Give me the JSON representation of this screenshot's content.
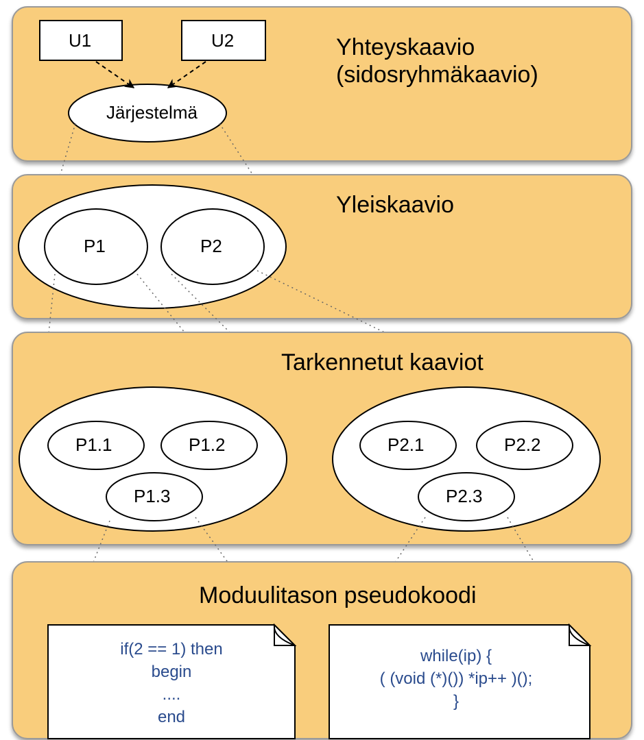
{
  "panels": {
    "context": {
      "title_line1": "Yhteyskaavio",
      "title_line2": "(sidosryhmäkaavio)",
      "actors": {
        "u1": "U1",
        "u2": "U2"
      },
      "system": "Järjestelmä"
    },
    "overview": {
      "title": "Yleiskaavio",
      "processes": {
        "p1": "P1",
        "p2": "P2"
      }
    },
    "detailed": {
      "title": "Tarkennetut kaaviot",
      "left": {
        "p11": "P1.1",
        "p12": "P1.2",
        "p13": "P1.3"
      },
      "right": {
        "p21": "P2.1",
        "p22": "P2.2",
        "p23": "P2.3"
      }
    },
    "pseudocode": {
      "title": "Moduulitason pseudokoodi",
      "left_code": {
        "l1": "if(2 == 1) then",
        "l2": "begin",
        "l3": "....",
        "l4": "end"
      },
      "right_code": {
        "l1": "while(ip) {",
        "l2": "( (void (*)()) *ip++ )();",
        "l3": "}"
      }
    }
  },
  "colors": {
    "panel_fill": "#f9cd7c",
    "panel_stroke": "#9a9a9a",
    "node_fill": "#ffffff",
    "node_stroke": "#000000",
    "dotted": "#666666"
  }
}
